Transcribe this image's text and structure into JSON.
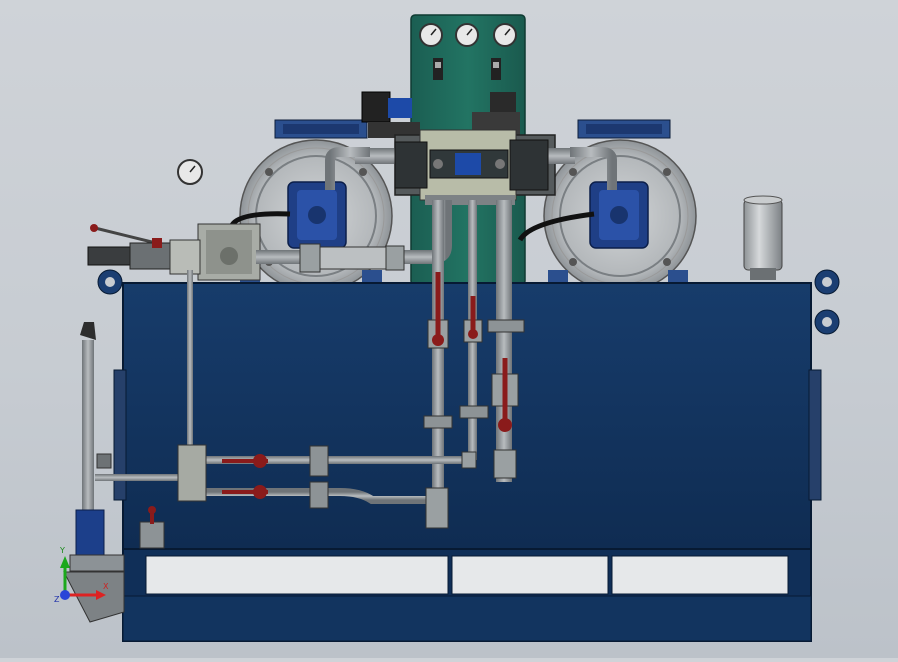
{
  "viewport": {
    "background_top": "#cfd3d8",
    "background_bottom": "#bcc2c9"
  },
  "colors": {
    "tank_blue": "#13355f",
    "tank_blue_dark": "#0c2444",
    "panel_green": "#1f6b5c",
    "motor_grey": "#bfc3c6",
    "pipe_grey": "#8c9296",
    "handle_red": "#8a1b1b",
    "valve_grey": "#9aa0a2",
    "solenoid_blue": "#1d4aa8"
  },
  "gauges": {
    "count": 4
  },
  "triad": {
    "x_label": "X",
    "y_label": "Y",
    "z_label": "Z"
  }
}
